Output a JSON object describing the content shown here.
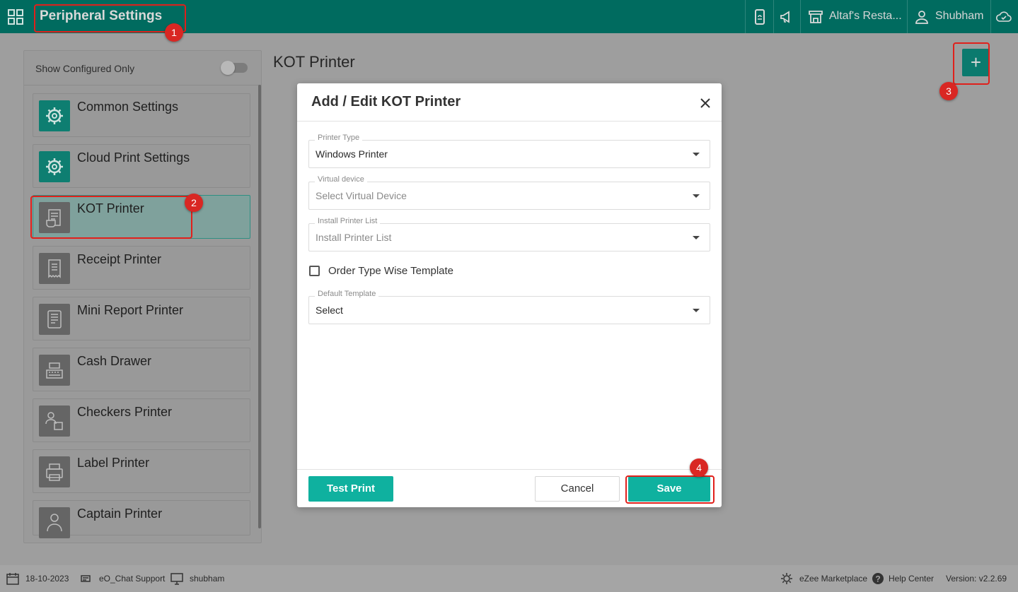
{
  "topbar": {
    "title": "Peripheral Settings",
    "restaurant": "Altaf's Resta...",
    "user": "Shubham",
    "icons": [
      "apps-grid-icon",
      "mobile-order-icon",
      "megaphone-icon",
      "store-icon",
      "user-icon",
      "cloud-check-icon"
    ]
  },
  "sidebar": {
    "show_configured_label": "Show Configured Only",
    "items": [
      {
        "label": "Common Settings",
        "icon": "gear-icon"
      },
      {
        "label": "Cloud Print Settings",
        "icon": "gear-icon"
      },
      {
        "label": "KOT Printer",
        "icon": "kot-printer-icon"
      },
      {
        "label": "Receipt Printer",
        "icon": "receipt-icon"
      },
      {
        "label": "Mini Report Printer",
        "icon": "report-printer-icon"
      },
      {
        "label": "Cash Drawer",
        "icon": "cash-register-icon"
      },
      {
        "label": "Checkers Printer",
        "icon": "checker-icon"
      },
      {
        "label": "Label Printer",
        "icon": "label-printer-icon"
      },
      {
        "label": "Captain Printer",
        "icon": "captain-icon"
      }
    ]
  },
  "main": {
    "heading": "KOT Printer",
    "add_label": "+"
  },
  "modal": {
    "title": "Add / Edit KOT Printer",
    "fields": {
      "printer_type": {
        "label": "Printer Type",
        "value": "Windows Printer"
      },
      "virtual_device": {
        "label": "Virtual device",
        "placeholder": "Select Virtual Device"
      },
      "install_printer": {
        "label": "Install Printer List",
        "placeholder": "Install Printer List"
      },
      "default_template": {
        "label": "Default Template",
        "value": "Select"
      }
    },
    "order_type_label": "Order Type Wise Template",
    "test_print_label": "Test Print",
    "cancel_label": "Cancel",
    "save_label": "Save"
  },
  "annotations": [
    "1",
    "2",
    "3",
    "4"
  ],
  "footer": {
    "date": "18-10-2023",
    "chat_support": "eO_Chat Support",
    "terminal": "shubham",
    "marketplace": "eZee Marketplace",
    "help": "Help Center",
    "version": "Version: v2.2.69"
  },
  "colors": {
    "header": "#006b5f",
    "accent": "#0fb19f",
    "annotation_red": "#e0201b"
  }
}
